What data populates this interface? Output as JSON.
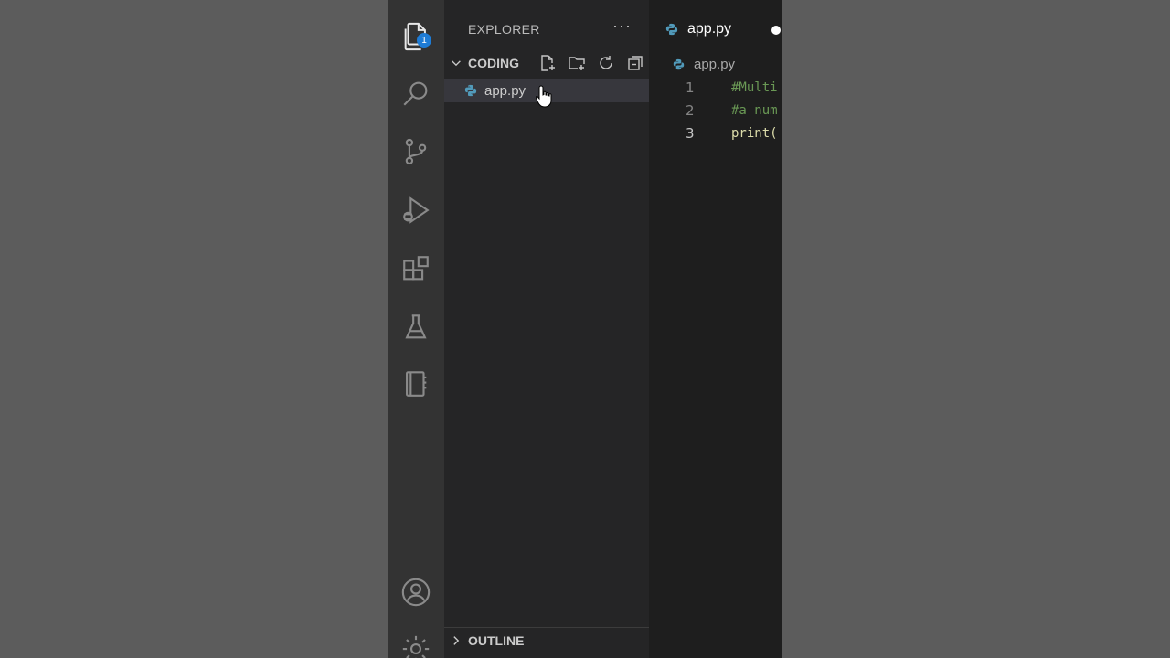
{
  "activity_bar": {
    "items": [
      {
        "name": "explorer",
        "icon": "files-icon",
        "badge": "1"
      },
      {
        "name": "search",
        "icon": "search-icon"
      },
      {
        "name": "source-control",
        "icon": "source-control-icon"
      },
      {
        "name": "run-debug",
        "icon": "run-debug-icon"
      },
      {
        "name": "extensions",
        "icon": "extensions-icon"
      },
      {
        "name": "testing",
        "icon": "flask-icon"
      },
      {
        "name": "notebook",
        "icon": "notebook-icon"
      }
    ],
    "bottom": [
      {
        "name": "accounts",
        "icon": "account-icon"
      },
      {
        "name": "manage",
        "icon": "gear-icon"
      }
    ]
  },
  "sidebar": {
    "title": "EXPLORER",
    "more": "···",
    "folder": "CODING",
    "folder_actions": [
      "new-file-icon",
      "new-folder-icon",
      "refresh-icon",
      "collapse-all-icon"
    ],
    "files": [
      {
        "name": "app.py",
        "icon": "python-icon"
      }
    ],
    "outline_label": "OUTLINE"
  },
  "editor": {
    "tab": {
      "label": "app.py",
      "dirty": true
    },
    "breadcrumb": "app.py",
    "lines": [
      {
        "num": "1",
        "text": "#Multi",
        "kind": "comment"
      },
      {
        "num": "2",
        "text": "#a num",
        "kind": "comment"
      },
      {
        "num": "3",
        "text": "print(",
        "kind": "fn"
      }
    ]
  },
  "colors": {
    "activity_bar": "#333333",
    "sidebar": "#252526",
    "editor": "#1e1e1e",
    "badge": "#1e7cd6",
    "python_icon": "#519aba",
    "comment": "#6a9955",
    "function": "#dcdcaa"
  }
}
